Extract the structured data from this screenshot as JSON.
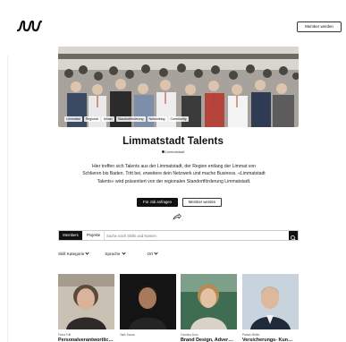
{
  "header": {
    "logo_icon": "lll-logo-icon",
    "member_button_label": "Member werden"
  },
  "hero": {
    "tags": [
      "Limmattal",
      "Regional",
      "Urban",
      "Standortförderung",
      "Networking",
      "Community"
    ]
  },
  "profile": {
    "title": "Limmatstadt Talents",
    "location": "Limmatstadt",
    "description": "Hier treffen sich Talents aus der Limmatstadt, der Region entlang der Limmat von Schlieren bis Baden. Tritt bei, erweitere dein Netzwerk und mache Business. «Limmatstadt Talents» wird präsentiert von der regionalen Standortförderung Limmatstadt.",
    "primary_button": "Für Job anfragen",
    "secondary_button": "Member werden",
    "share_icon": "share-icon"
  },
  "search": {
    "tab_members": "Members",
    "tab_projects": "Projekte",
    "placeholder": "Suche nach Skills und Namen",
    "search_icon": "search-icon"
  },
  "filters": [
    {
      "label": "Skill Kategorie"
    },
    {
      "label": "Sprache"
    },
    {
      "label": "Ort"
    }
  ],
  "members": [
    {
      "name": "Fiona Tritt",
      "role": "Personalverantwortliche im"
    },
    {
      "name": "Tarik Sousa",
      "role": ""
    },
    {
      "name": "Carolina Duro",
      "role": "Brand Design, Adver…"
    },
    {
      "name": "Patrick Müller",
      "role": "Versicherungs- Kun…"
    }
  ]
}
